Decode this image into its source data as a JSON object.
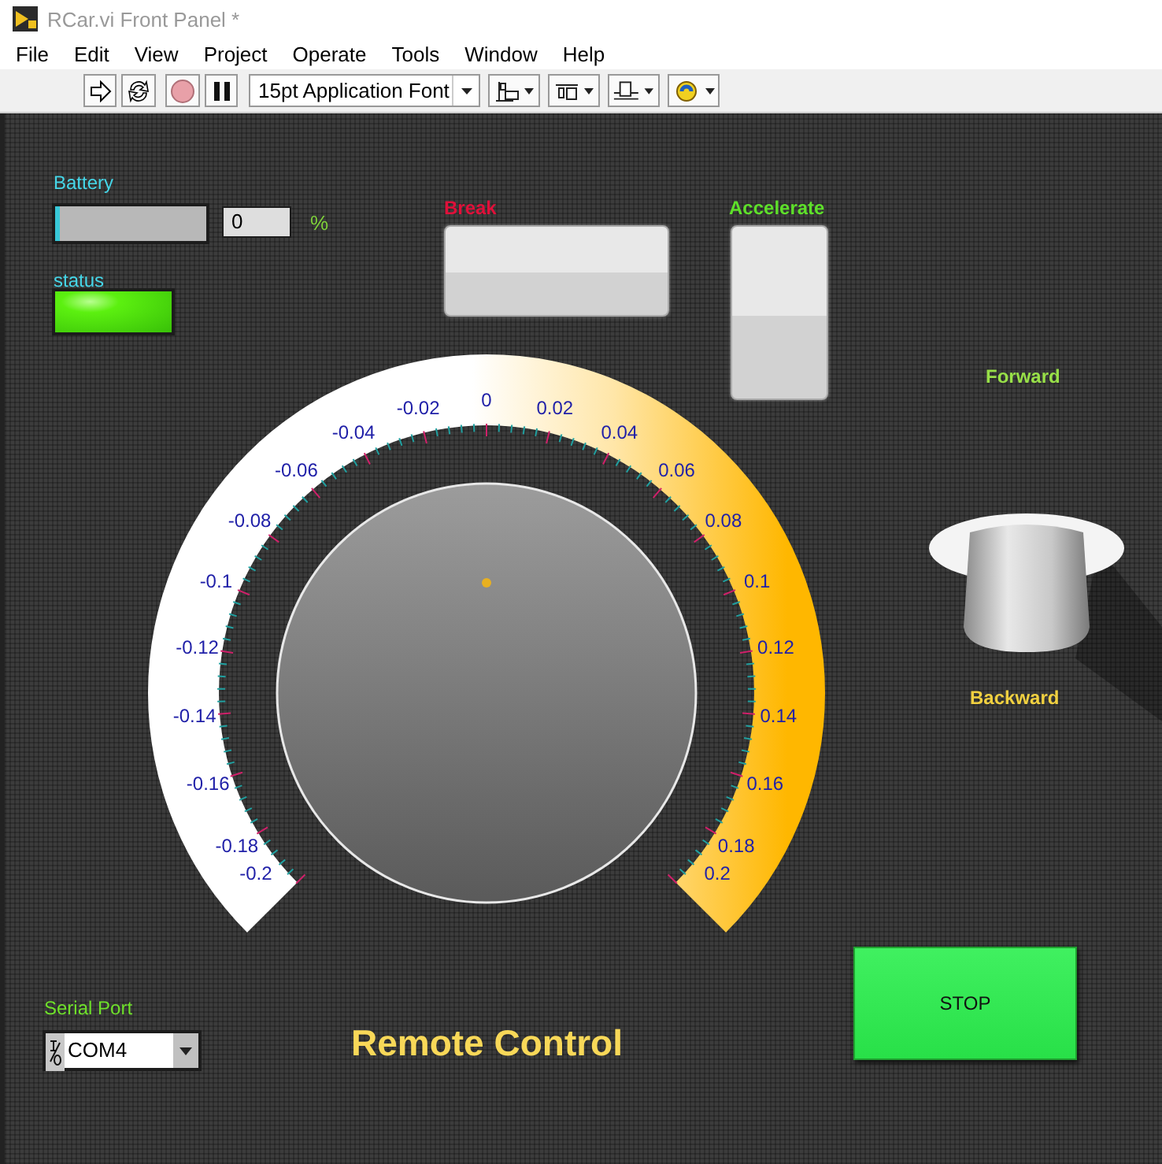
{
  "window": {
    "title": "RCar.vi Front Panel *"
  },
  "menu": [
    "File",
    "Edit",
    "View",
    "Project",
    "Operate",
    "Tools",
    "Window",
    "Help"
  ],
  "toolbar": {
    "font": "15pt Application Font"
  },
  "battery": {
    "label": "Battery",
    "level": 0,
    "value": "0",
    "unit": "%"
  },
  "status": {
    "label": "status",
    "on": true
  },
  "break_button": {
    "label": "Break",
    "on": false
  },
  "accelerate_button": {
    "label": "Accelerate",
    "on": false
  },
  "direction_switch": {
    "top_label": "Forward",
    "bottom_label": "Backward",
    "on": false
  },
  "knob": {
    "level": 0.5,
    "scale": [
      "-0.2",
      "-0.18",
      "-0.16",
      "-0.14",
      "-0.12",
      "-0.1",
      "-0.08",
      "-0.06",
      "-0.04",
      "-0.02",
      "0",
      "0.02",
      "0.04",
      "0.06",
      "0.08",
      "0.1",
      "0.12",
      "0.14",
      "0.16",
      "0.18",
      "0.2"
    ]
  },
  "serial_port": {
    "label": "Serial Port",
    "value": "COM4"
  },
  "title": "Remote Control",
  "stop_button": {
    "label": "STOP",
    "on": false
  }
}
